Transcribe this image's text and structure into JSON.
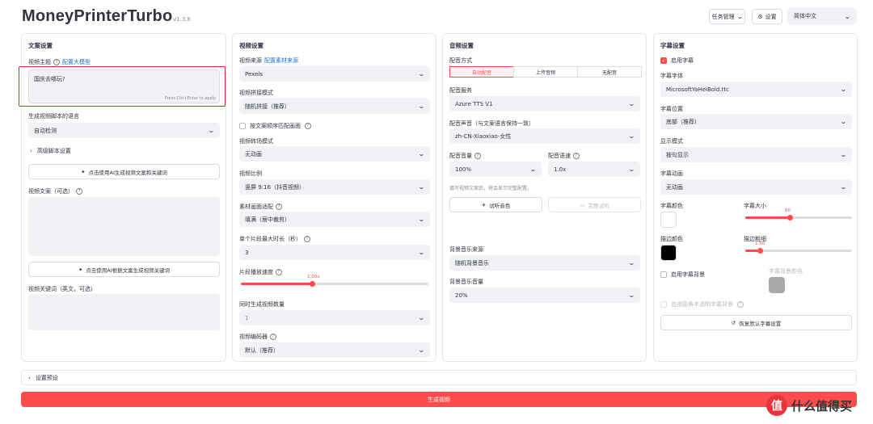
{
  "header": {
    "title": "MoneyPrinterTurbo",
    "version": "v1.3.6",
    "task_button": "任务管理",
    "settings_button": "设置",
    "language": "简体中文"
  },
  "script_panel": {
    "title": "文案设置",
    "topic_label": "视频主题",
    "topic_link": "配置大模型",
    "topic_value": "国庆去哪玩?",
    "topic_hint": "Press Ctrl+Enter to apply",
    "lang_label": "生成视频脚本的语言",
    "lang_value": "自动检测",
    "advanced": "高级脚本设置",
    "gen_script_button": "点击使用AI生成视频文案和关键词",
    "script_label": "视频文案（可选）",
    "gen_keywords_button": "点击使用AI根据文案生成视频关键词",
    "keywords_label": "视频关键词（英文，可选）"
  },
  "video_panel": {
    "title": "视频设置",
    "source_label": "视频来源",
    "source_link": "配置素材来源",
    "source_value": "Pexels",
    "concat_label": "视频拼接模式",
    "concat_value": "随机拼接（推荐）",
    "order_checkbox": "按文案顺序匹配画面",
    "transition_label": "视频转场模式",
    "transition_value": "无动画",
    "ratio_label": "视频比例",
    "ratio_value": "竖屏 9:16（抖音视频）",
    "fit_label": "素材画面适配",
    "fit_value": "填满（居中裁剪）",
    "clip_label": "单个片段最大时长（秒）",
    "clip_value": "3",
    "speed_label": "片段播放速度",
    "speed_value": "1.00x",
    "speed_fraction": 0.38,
    "count_label": "同时生成视频数量",
    "count_value": "1",
    "codec_label": "视频编码器",
    "codec_value": "默认（推荐）"
  },
  "audio_panel": {
    "title": "音频设置",
    "mode_label": "配音方式",
    "mode_options": [
      "自动配音",
      "上传音频",
      "无配音"
    ],
    "service_label": "配音服务",
    "service_value": "Azure TTS V1",
    "voice_label": "配音声音（与文案语言保持一致）",
    "voice_value": "zh-CN-Xiaoxiao-女性",
    "volume_label": "配音音量",
    "volume_value": "100%",
    "rate_label": "配音语速",
    "rate_value": "1.0x",
    "hint": "填写视频文案后，将会显示完整配置。",
    "try_button": "试听音色",
    "adv_button": "完整试听",
    "bgm_label": "背景音乐来源",
    "bgm_value": "随机背景音乐",
    "bgm_volume_label": "背景音乐音量",
    "bgm_volume_value": "20%"
  },
  "subtitle_panel": {
    "title": "字幕设置",
    "enable_label": "启用字幕",
    "font_label": "字幕字体",
    "font_value": "MicrosoftYaHeiBold.ttc",
    "position_label": "字幕位置",
    "position_value": "底部（推荐）",
    "display_label": "显示模式",
    "display_value": "按句显示",
    "anim_label": "字幕动画",
    "anim_value": "无动画",
    "color_label": "字幕颜色",
    "size_label": "字幕大小",
    "size_value": "60",
    "size_fraction": 0.42,
    "stroke_color_label": "描边颜色",
    "stroke_width_label": "描边粗细",
    "stroke_width_value": "1.50",
    "stroke_fraction": 0.14,
    "bg_label": "启用字幕背景",
    "bg_color_label": "字幕背景颜色",
    "transparent_label": "启用圆角半透明字幕背景",
    "reset_button": "恢复默认字幕设置",
    "colors": {
      "font": "#ffffff",
      "stroke": "#000000",
      "bg": "#a9a9a9"
    }
  },
  "footer": {
    "preset_expander": "设置预设",
    "generate_button": "生成视频"
  },
  "watermark": {
    "logo_char": "值",
    "text": "什么值得买"
  }
}
